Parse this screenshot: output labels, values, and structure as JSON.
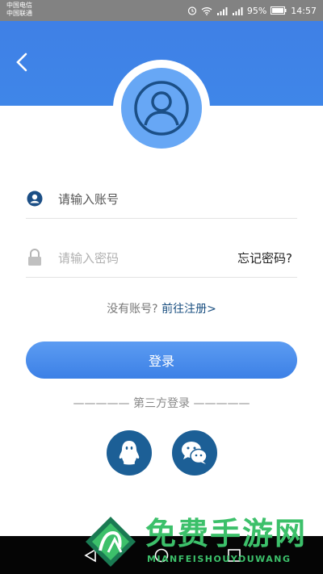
{
  "status_bar": {
    "carrier1": "中国电信",
    "carrier2": "中国联通",
    "battery": "95%",
    "time": "14:57"
  },
  "header": {
    "back_icon": "chevron-left-icon"
  },
  "avatar": {
    "icon": "user-icon"
  },
  "account": {
    "placeholder": "请输入账号",
    "icon": "user-circle-icon"
  },
  "password": {
    "placeholder": "请输入密码",
    "icon": "lock-icon",
    "forgot": "忘记密码?"
  },
  "register": {
    "question": "没有账号?",
    "link": "前往注册>"
  },
  "login_button": "登录",
  "third_party": {
    "title": "————— 第三方登录 —————",
    "qq_icon": "qq-icon",
    "wechat_icon": "wechat-icon"
  },
  "watermark": {
    "title": "免费手游网",
    "subtitle": "MIANFEISHOUYOUWANG"
  },
  "colors": {
    "primary": "#3f80e6",
    "avatar": "#67a7f5",
    "dark_blue": "#1c5f96",
    "watermark_green": "#3cc06a"
  }
}
